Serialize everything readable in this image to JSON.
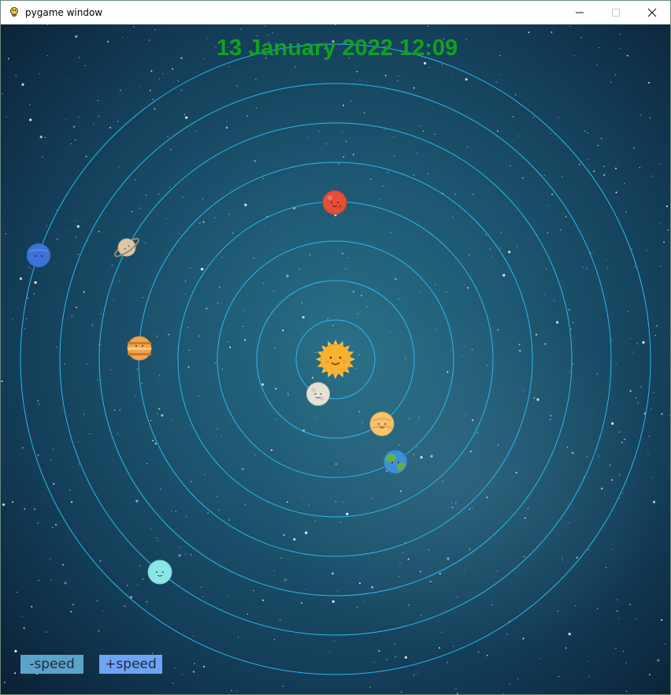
{
  "window": {
    "title": "pygame window",
    "controls": {
      "minimize": "—",
      "maximize": "☐",
      "close": "✕"
    }
  },
  "header": {
    "datetime": "13 January 2022 12:09"
  },
  "controls": {
    "speed_down_label": "-speed",
    "speed_up_label": "+speed"
  },
  "colors": {
    "datetime_text": "#12a11e",
    "orbit": "#2fb6ee",
    "speed_down_bg": "#5ba3c9",
    "speed_up_bg": "#6fa4f5",
    "space_dark": "#0b1f33",
    "space_mid": "#1d5a73"
  },
  "bodies": [
    {
      "name": "sun",
      "color": "#f7b232",
      "icon": "sun-icon"
    },
    {
      "name": "mercury",
      "color": "#e2ddd2",
      "icon": "mercury-icon"
    },
    {
      "name": "venus",
      "color": "#f6c26a",
      "icon": "venus-icon"
    },
    {
      "name": "earth",
      "color": "#3d8fd8",
      "icon": "earth-icon"
    },
    {
      "name": "mars",
      "color": "#e2503a",
      "icon": "mars-icon"
    },
    {
      "name": "jupiter",
      "color": "#f0a54a",
      "icon": "jupiter-icon"
    },
    {
      "name": "saturn",
      "color": "#d9c5a5",
      "icon": "saturn-icon"
    },
    {
      "name": "uranus",
      "color": "#8ce6e6",
      "icon": "uranus-icon"
    },
    {
      "name": "neptune",
      "color": "#3d73d6",
      "icon": "neptune-icon"
    }
  ]
}
